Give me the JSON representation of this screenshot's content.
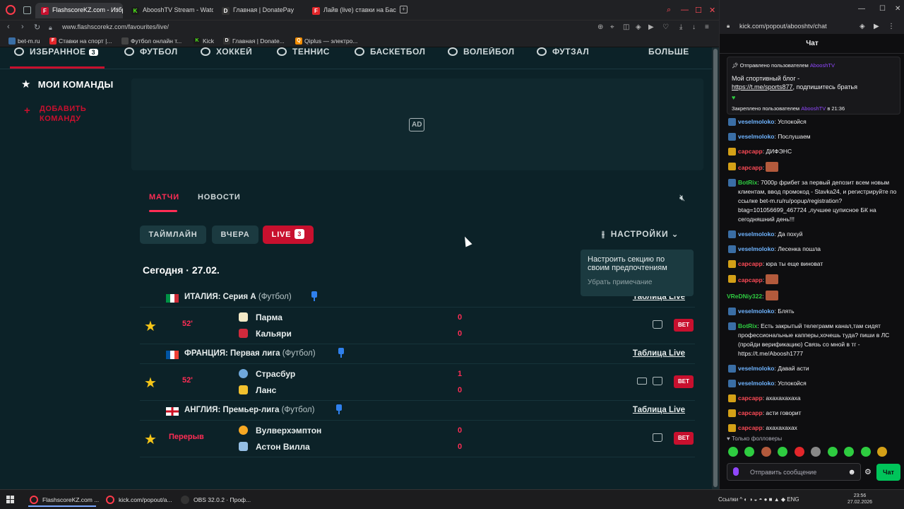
{
  "browser": {
    "tabs": [
      {
        "label": "FlashscoreKZ.com - Избр",
        "favicon": "fs-icon",
        "color": "#c8102e"
      },
      {
        "label": "AbooshTV Stream - Watc",
        "favicon": "kick-icon",
        "color": "#53fc18"
      },
      {
        "label": "Главная | DonatePay",
        "favicon": "donatepay-icon",
        "color": "#333"
      },
      {
        "label": "Лайв (live) ставки на Бас",
        "favicon": "fonbet-icon",
        "color": "#e3262a"
      }
    ],
    "url": "www.flashscorekz.com/favourites/live/",
    "bookmarks": [
      {
        "label": "bet-m.ru",
        "color": "#3a6ea5"
      },
      {
        "label": "Ставки на спорт |...",
        "color": "#e3262a"
      },
      {
        "label": "Футбол онлайн т...",
        "color": "#444"
      },
      {
        "label": "Kick",
        "color": "#53fc18"
      },
      {
        "label": "Главная | Donate...",
        "color": "#333"
      },
      {
        "label": "Qiplus — электро...",
        "color": "#f28c00"
      }
    ]
  },
  "site": {
    "topnav": [
      {
        "label": "ИЗБРАННОЕ",
        "badge": "3"
      },
      {
        "label": "ФУТБОЛ"
      },
      {
        "label": "ХОККЕЙ"
      },
      {
        "label": "ТЕННИС"
      },
      {
        "label": "БАСКЕТБОЛ"
      },
      {
        "label": "ВОЛЕЙБОЛ"
      },
      {
        "label": "ФУТЗАЛ"
      },
      {
        "label": "БОЛЬШЕ"
      }
    ],
    "my_teams": "МОИ КОМАНДЫ",
    "add_team_line1": "ДОБАВИТЬ",
    "add_team_line2": "КОМАНДУ",
    "ad_label": "AD",
    "content_tabs": [
      "МАТЧИ",
      "НОВОСТИ"
    ],
    "filters": {
      "timeline": "ТАЙМЛАЙН",
      "yesterday": "ВЧЕРА",
      "live": "LIVE",
      "live_count": "3"
    },
    "settings_label": "НАСТРОЙКИ",
    "tooltip": {
      "text": "Настроить секцию по своим предпочтениям",
      "dismiss": "Убрать примечание"
    },
    "date_heading": "Сегодня · 27.02.",
    "table_live_label": "Таблица Live",
    "bet_label": "BET",
    "leagues": [
      {
        "country": "ИТАЛИЯ: Серия А",
        "sport": "(Футбол)",
        "match": {
          "time": "52'",
          "home": "Парма",
          "away": "Кальяри",
          "home_score": "0",
          "away_score": "0"
        }
      },
      {
        "country": "ФРАНЦИЯ: Первая лига",
        "sport": "(Футбол)",
        "match": {
          "time": "52'",
          "home": "Страсбур",
          "away": "Ланс",
          "home_score": "1",
          "away_score": "0"
        }
      },
      {
        "country": "АНГЛИЯ: Премьер-лига",
        "sport": "(Футбол)",
        "match": {
          "time": "Перерыв",
          "home": "Вулверхэмптон",
          "away": "Астон Вилла",
          "home_score": "0",
          "away_score": "0"
        }
      }
    ]
  },
  "chat": {
    "url": "kick.com/popout/abooshtv/chat",
    "header": "Чат",
    "pinned": {
      "sent_by_prefix": "Отправлено пользователем",
      "sent_by_user": "AbooshTV",
      "message_pre": "Мой спортивный блог -",
      "message_link": "https://t.me/sports877",
      "message_post": ", подпишитесь братья",
      "pinned_by_prefix": "Закреплено пользователем",
      "pinned_by_user": "AbooshTV",
      "pinned_time": "в 21:36"
    },
    "messages": [
      {
        "user": "veselmoloko",
        "text": ": Успокойся",
        "color": "#6fb4ff",
        "badge": "blue"
      },
      {
        "user": "veselmoloko",
        "text": ": Послушаем",
        "color": "#6fb4ff",
        "badge": "blue"
      },
      {
        "user": "сарсарр",
        "text": ": ДИФЭНС",
        "color": "#ff4b57",
        "badge": "gold"
      },
      {
        "user": "сарсарр",
        "text": ":",
        "color": "#ff4b57",
        "badge": "gold",
        "emote": true
      },
      {
        "user": "BotRix",
        "text": ": 7000р фрибет за первый депозит всем новым клиентам, ввод промокод - Stavka24, и регистрируйте по ссылке bet-m.ru/ru/popup/registration?btag=101056699_467724 ,лучшее цуписное БК на сегодняшний день!!!",
        "color": "#2ecc40",
        "badge": "blue"
      },
      {
        "user": "veselmoloko",
        "text": ": Да похуй",
        "color": "#6fb4ff",
        "badge": "blue"
      },
      {
        "user": "veselmoloko",
        "text": ": Лесенка пошла",
        "color": "#6fb4ff",
        "badge": "blue"
      },
      {
        "user": "сарсарр",
        "text": ": юра ты еще виноват",
        "color": "#ff4b57",
        "badge": "gold"
      },
      {
        "user": "сарсарр",
        "text": ":",
        "color": "#ff4b57",
        "badge": "gold",
        "emote": true
      },
      {
        "user": "VReDNiy322",
        "text": ":",
        "color": "#2ecc40",
        "badge": "none",
        "emote": true
      },
      {
        "user": "veselmoloko",
        "text": ": Блять",
        "color": "#6fb4ff",
        "badge": "blue"
      },
      {
        "user": "BotRix",
        "text": ": Есть закрытый телеграмм канал,там сидят профессиональные капперы,хочешь туда? пиши в ЛС (пройди верификацию) Связь со мной в тг - https://t.me/Aboosh1777",
        "color": "#2ecc40",
        "badge": "blue"
      },
      {
        "user": "veselmoloko",
        "text": ": Давай асти",
        "color": "#6fb4ff",
        "badge": "blue"
      },
      {
        "user": "veselmoloko",
        "text": ": Успокойся",
        "color": "#6fb4ff",
        "badge": "blue"
      },
      {
        "user": "сарсарр",
        "text": ": ахахахахаха",
        "color": "#ff4b57",
        "badge": "gold"
      },
      {
        "user": "сарсарр",
        "text": ": асти говорит",
        "color": "#ff4b57",
        "badge": "gold"
      },
      {
        "user": "сарсарр",
        "text": ": ахахахахах",
        "color": "#ff4b57",
        "badge": "gold"
      }
    ],
    "followers_only": "♥ Только фолловеры",
    "input_placeholder": "Отправить сообщение",
    "send_label": "Чат"
  },
  "taskbar": {
    "apps": [
      "FlashscoreKZ.com ...",
      "kick.com/popout/a...",
      "OBS 32.0.2 · Проф..."
    ],
    "tray_label": "Ссылки",
    "lang": "ENG",
    "time": "23:56",
    "date": "27.02.2026"
  }
}
